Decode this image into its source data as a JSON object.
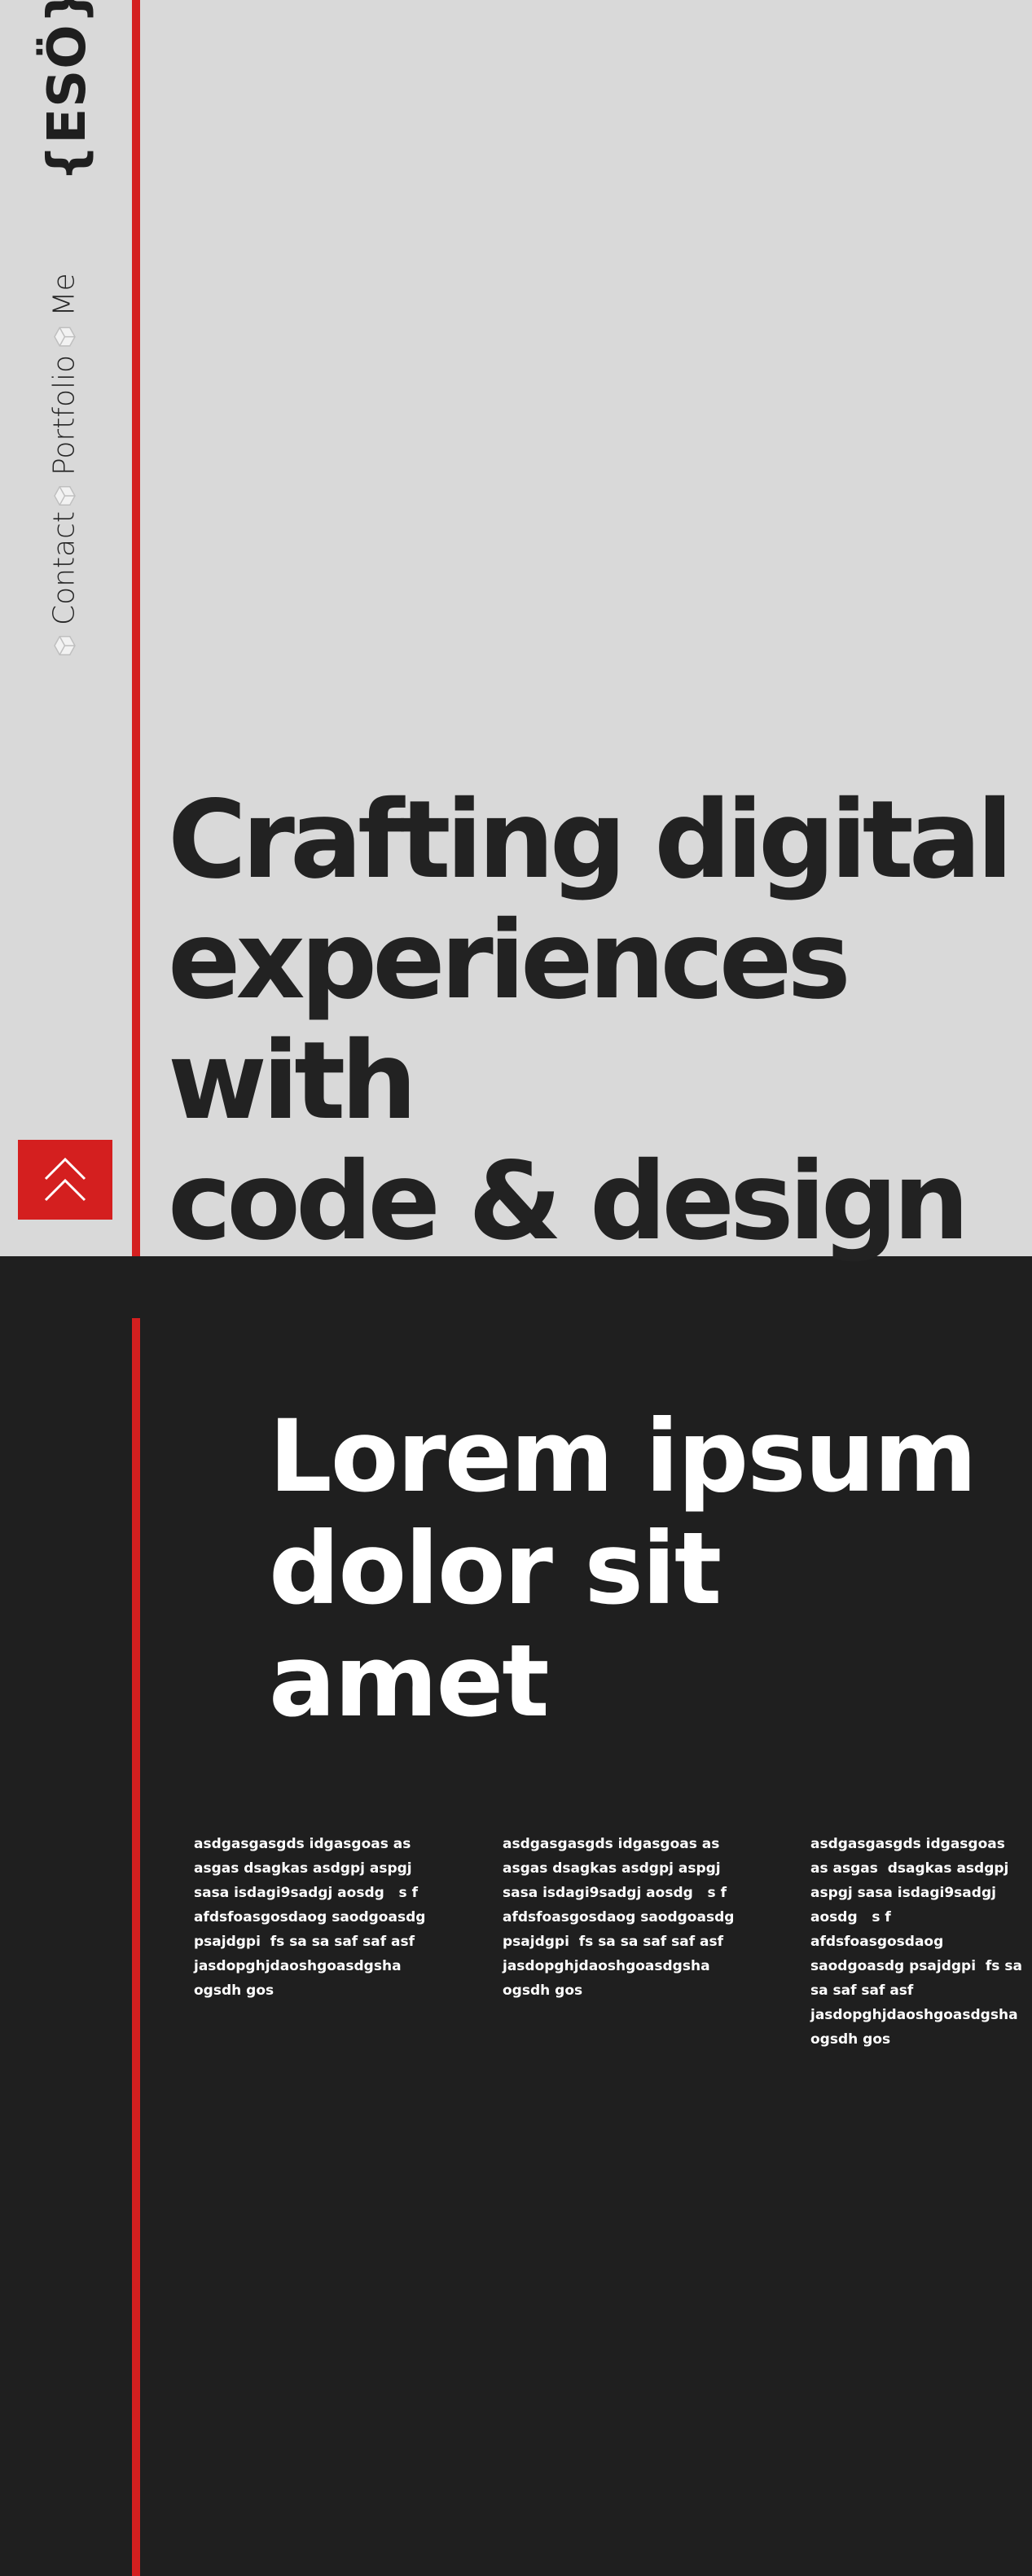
{
  "logo": {
    "text": "{ESÖ}"
  },
  "nav": {
    "items": [
      {
        "label": "Contact",
        "icon": "cube-icon"
      },
      {
        "label": "Portfolio",
        "icon": "cube-icon"
      },
      {
        "label": "Me",
        "icon": "cube-icon"
      }
    ]
  },
  "hero": {
    "headline_line1": "Crafting digital",
    "headline_line2": "experiences with",
    "headline_line3": "code & design"
  },
  "scroll_top": {
    "icon": "double-chevron-up-icon"
  },
  "section2": {
    "title_line1": "Lorem ipsum",
    "title_line2": "dolor sit amet",
    "columns": [
      "asdgasgasgds idgasgoas as asgas dsagkas asdgpj aspgj sasa isdagi9sadgj aosdg   s f afdsfoasgosdaog saodgoasdg psajdgpi  fs sa sa saf saf asf jasdopghjdaoshgoasdgsha ogsdh gos",
      "asdgasgasgds idgasgoas as asgas dsagkas asdgpj aspgj sasa isdagi9sadgj aosdg   s f afdsfoasgosdaog saodgoasdg psajdgpi  fs sa sa saf saf asf jasdopghjdaoshgoasdgsha ogsdh gos",
      "asdgasgasgds idgasgoas as asgas  dsagkas asdgpj aspgj sasa isdagi9sadgj aosdg   s f afdsfoasgosdaog saodgoasdg psajdgpi  fs sa sa saf saf asf jasdopghjdaoshgoasdgsha ogsdh gos"
    ]
  },
  "colors": {
    "accent": "#d41f1f",
    "hero_bg": "#d9d9d9",
    "dark_bg": "#1f1f1f",
    "text_dark": "#222222",
    "text_light": "#ffffff"
  }
}
